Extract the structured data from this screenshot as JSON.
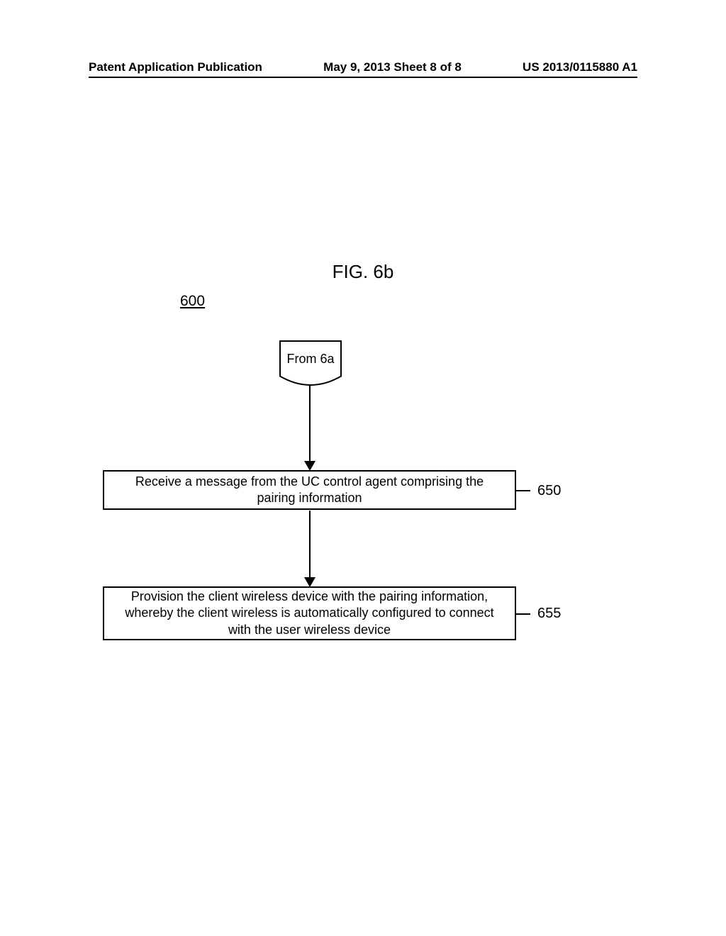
{
  "header": {
    "left": "Patent Application Publication",
    "center": "May 9, 2013  Sheet 8 of 8",
    "right": "US 2013/0115880 A1"
  },
  "figure": {
    "title": "FIG. 6b",
    "number": "600"
  },
  "connector": {
    "label": "From 6a"
  },
  "boxes": {
    "b650": {
      "text": "Receive a message from the UC control agent comprising the pairing information",
      "ref": "650"
    },
    "b655": {
      "text": "Provision the client wireless device with the pairing information, whereby the client wireless is automatically configured to connect with  the user wireless device",
      "ref": "655"
    }
  }
}
